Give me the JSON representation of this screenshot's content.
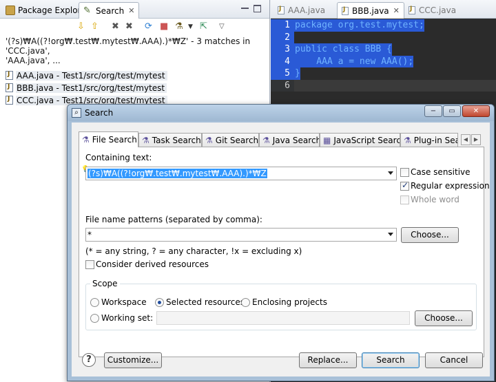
{
  "left_view": {
    "tabs": [
      {
        "label": "Package Explorer"
      },
      {
        "label": "Search"
      }
    ],
    "summary_line1": "'(?s)₩A((?!org₩.test₩.mytest₩.AAA).)*₩Z' - 3 matches in 'CCC.java',",
    "summary_line2": "'AAA.java', ...",
    "results": [
      "AAA.java - Test1/src/org/test/mytest",
      "BBB.java - Test1/src/org/test/mytest",
      "CCC.java - Test1/src/org/test/mytest"
    ]
  },
  "editor": {
    "tabs": [
      "AAA.java",
      "BBB.java",
      "CCC.java"
    ],
    "active_tab": "BBB.java",
    "lines": [
      {
        "num": "1",
        "text": "package org.test.mytest;"
      },
      {
        "num": "2",
        "text": ""
      },
      {
        "num": "3",
        "text": "public class BBB {"
      },
      {
        "num": "4",
        "text": "    AAA a = new AAA();"
      },
      {
        "num": "5",
        "text": "}"
      },
      {
        "num": "6",
        "text": ""
      }
    ]
  },
  "dialog": {
    "title": "Search",
    "window_buttons": {
      "minimize": "−",
      "maximize": "▭",
      "close": "✕"
    },
    "tabs": [
      "File Search",
      "Task Search",
      "Git Search",
      "Java Search",
      "JavaScript Search",
      "Plug-in Sea"
    ],
    "tab_scroll": {
      "left": "◀",
      "right": "▶"
    },
    "containing_text_label": "Containing text:",
    "containing_text_value": "(?s)₩A((?!org₩.test₩.mytest₩.AAA).)*₩Z",
    "case_sensitive_label": "Case sensitive",
    "case_sensitive": false,
    "regex_label": "Regular expression",
    "regex": true,
    "whole_word_label": "Whole word",
    "whole_word": false,
    "file_name_patterns_label": "File name patterns (separated by comma):",
    "file_name_patterns_value": "*",
    "choose_label": "Choose...",
    "patterns_hint": "(* = any string, ? = any character, !x = excluding x)",
    "derived_label": "Consider derived resources",
    "derived": false,
    "scope": {
      "title": "Scope",
      "workspace_label": "Workspace",
      "selected_label": "Selected resources",
      "enclosing_label": "Enclosing projects",
      "working_set_label": "Working set:",
      "choose_label": "Choose...",
      "selected_option": "Selected resources"
    },
    "help_label": "?",
    "customize_label": "Customize...",
    "replace_label": "Replace...",
    "search_label": "Search",
    "cancel_label": "Cancel"
  }
}
